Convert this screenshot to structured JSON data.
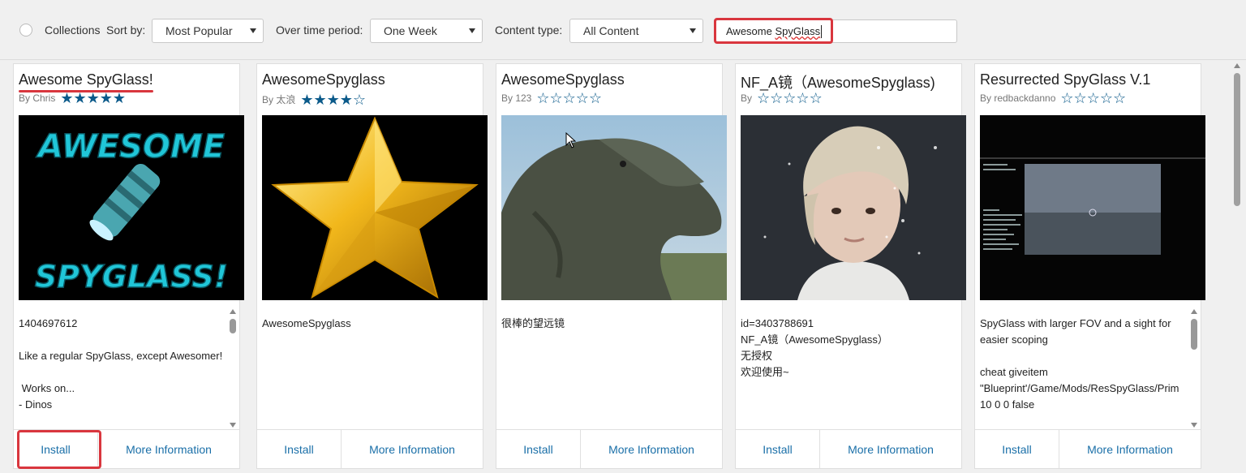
{
  "toolbar": {
    "collections_label": "Collections",
    "sort_label": "Sort by:",
    "sort_value": "Most Popular",
    "period_label": "Over time period:",
    "period_value": "One Week",
    "content_label": "Content type:",
    "content_value": "All Content",
    "search_prefix": "Awesome ",
    "search_suffix": "SpyGlass"
  },
  "cards": [
    {
      "title": "Awesome SpyGlass!",
      "by": "By Chris",
      "stars": "★★★★★",
      "description": "1404697612\n\nLike a regular SpyGlass, except Awesomer!\n\n Works on...\n- Dinos",
      "install": "Install",
      "more": "More Information",
      "thumb_text_top": "AWESOME",
      "thumb_text_bottom": "SPYGLASS!"
    },
    {
      "title": "AwesomeSpyglass",
      "by": "By 太浪",
      "stars": "★★★★☆",
      "description": "AwesomeSpyglass",
      "install": "Install",
      "more": "More Information"
    },
    {
      "title": "AwesomeSpyglass",
      "by": "By 123",
      "stars": "☆☆☆☆☆",
      "description": "很棒的望远镜",
      "install": "Install",
      "more": "More Information"
    },
    {
      "title": "NF_A镜（AwesomeSpyglass)",
      "by": "By",
      "stars": "☆☆☆☆☆",
      "description": "id=3403788691\nNF_A镜（AwesomeSpyglass）\n无授权\n欢迎使用~",
      "install": "Install",
      "more": "More Information"
    },
    {
      "title": "Resurrected SpyGlass V.1",
      "by": "By redbackdanno",
      "stars": "☆☆☆☆☆",
      "description": "SpyGlass with larger FOV and a sight for easier scoping\n\ncheat giveitem \"Blueprint'/Game/Mods/ResSpyGlass/Prim 10 0 0 false",
      "install": "Install",
      "more": "More Information"
    }
  ],
  "colors": {
    "accent": "#1a6fa8",
    "star": "#0b5a8a",
    "highlight": "#d9363e"
  }
}
